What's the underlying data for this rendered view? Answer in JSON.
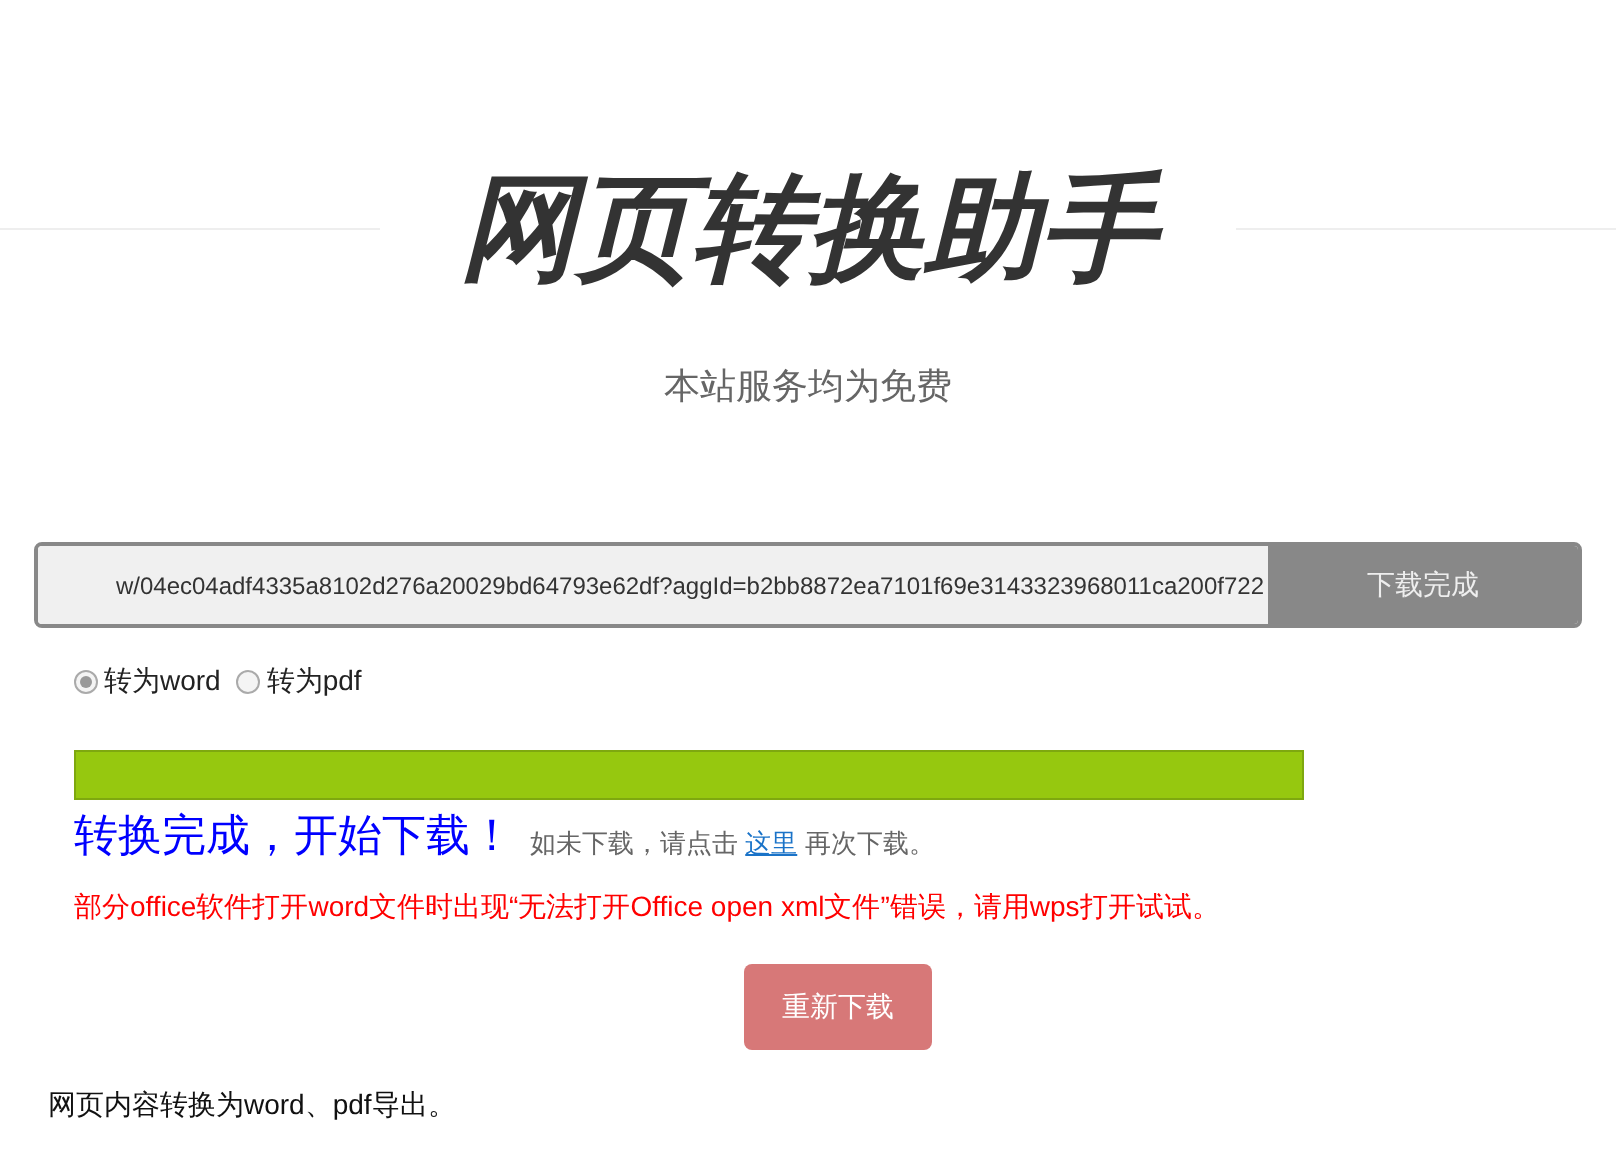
{
  "header": {
    "title": "网页转换助手",
    "subtitle": "本站服务均为免费"
  },
  "converter": {
    "url": "w/04ec04adf4335a8102d276a20029bd64793e62df?aggId=b2bb8872ea7101f69e3143323968011ca200f722",
    "button": "下载完成",
    "button_disabled": true
  },
  "formats": [
    {
      "label": "转为word",
      "selected": true
    },
    {
      "label": "转为pdf",
      "selected": false
    }
  ],
  "progress": {
    "level": 1
  },
  "status": {
    "headline": "转换完成，开始下载！",
    "hint_before": "如未下载，请点击",
    "link": "这里",
    "hint_after": "再次下载。"
  },
  "warning": "部分office软件打开word文件时出现“无法打开Office open xml文件”错误，请用wps打开试试。",
  "redownload_button": "重新下载",
  "footer": "网页内容转换为word、pdf导出。"
}
